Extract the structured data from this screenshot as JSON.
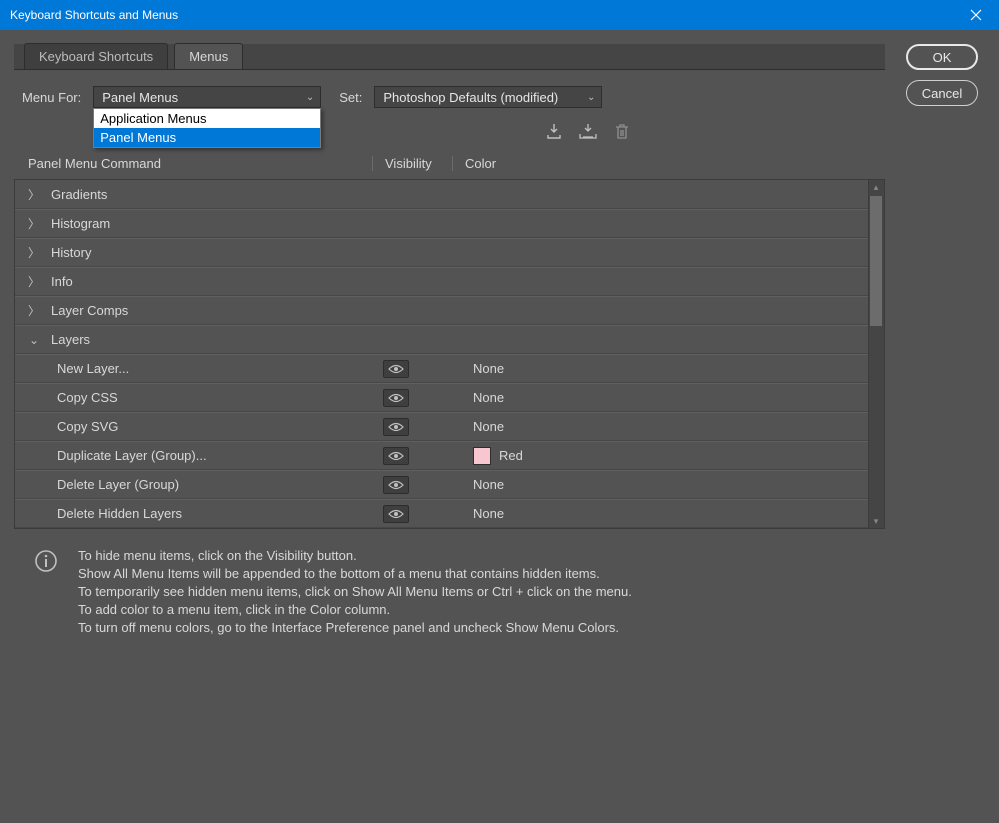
{
  "window": {
    "title": "Keyboard Shortcuts and Menus"
  },
  "tabs": {
    "shortcuts": "Keyboard Shortcuts",
    "menus": "Menus"
  },
  "labels": {
    "menu_for": "Menu For:",
    "set": "Set:"
  },
  "dropdowns": {
    "menu_for": {
      "value": "Panel Menus",
      "options": [
        "Application Menus",
        "Panel Menus"
      ]
    },
    "set": {
      "value": "Photoshop Defaults (modified)"
    }
  },
  "col_headers": {
    "command": "Panel Menu Command",
    "visibility": "Visibility",
    "color": "Color"
  },
  "tree": {
    "collapsed": [
      "Gradients",
      "Histogram",
      "History",
      "Info",
      "Layer Comps"
    ],
    "expanded_label": "Layers",
    "commands": [
      {
        "label": "New Layer...",
        "color": "None"
      },
      {
        "label": "Copy CSS",
        "color": "None"
      },
      {
        "label": "Copy SVG",
        "color": "None"
      },
      {
        "label": "Duplicate Layer (Group)...",
        "color": "Red",
        "swatch": "#f7c6ce"
      },
      {
        "label": "Delete Layer (Group)",
        "color": "None"
      },
      {
        "label": "Delete Hidden Layers",
        "color": "None"
      }
    ]
  },
  "info": {
    "l1": "To hide menu items, click on the Visibility button.",
    "l2": "Show All Menu Items will be appended to the bottom of a menu that contains hidden items.",
    "l3": "To temporarily see hidden menu items, click on Show All Menu Items or Ctrl + click on the menu.",
    "l4": "To add color to a menu item, click in the Color column.",
    "l5": "To turn off menu colors, go to the Interface Preference panel and uncheck Show Menu Colors."
  },
  "buttons": {
    "ok": "OK",
    "cancel": "Cancel"
  }
}
